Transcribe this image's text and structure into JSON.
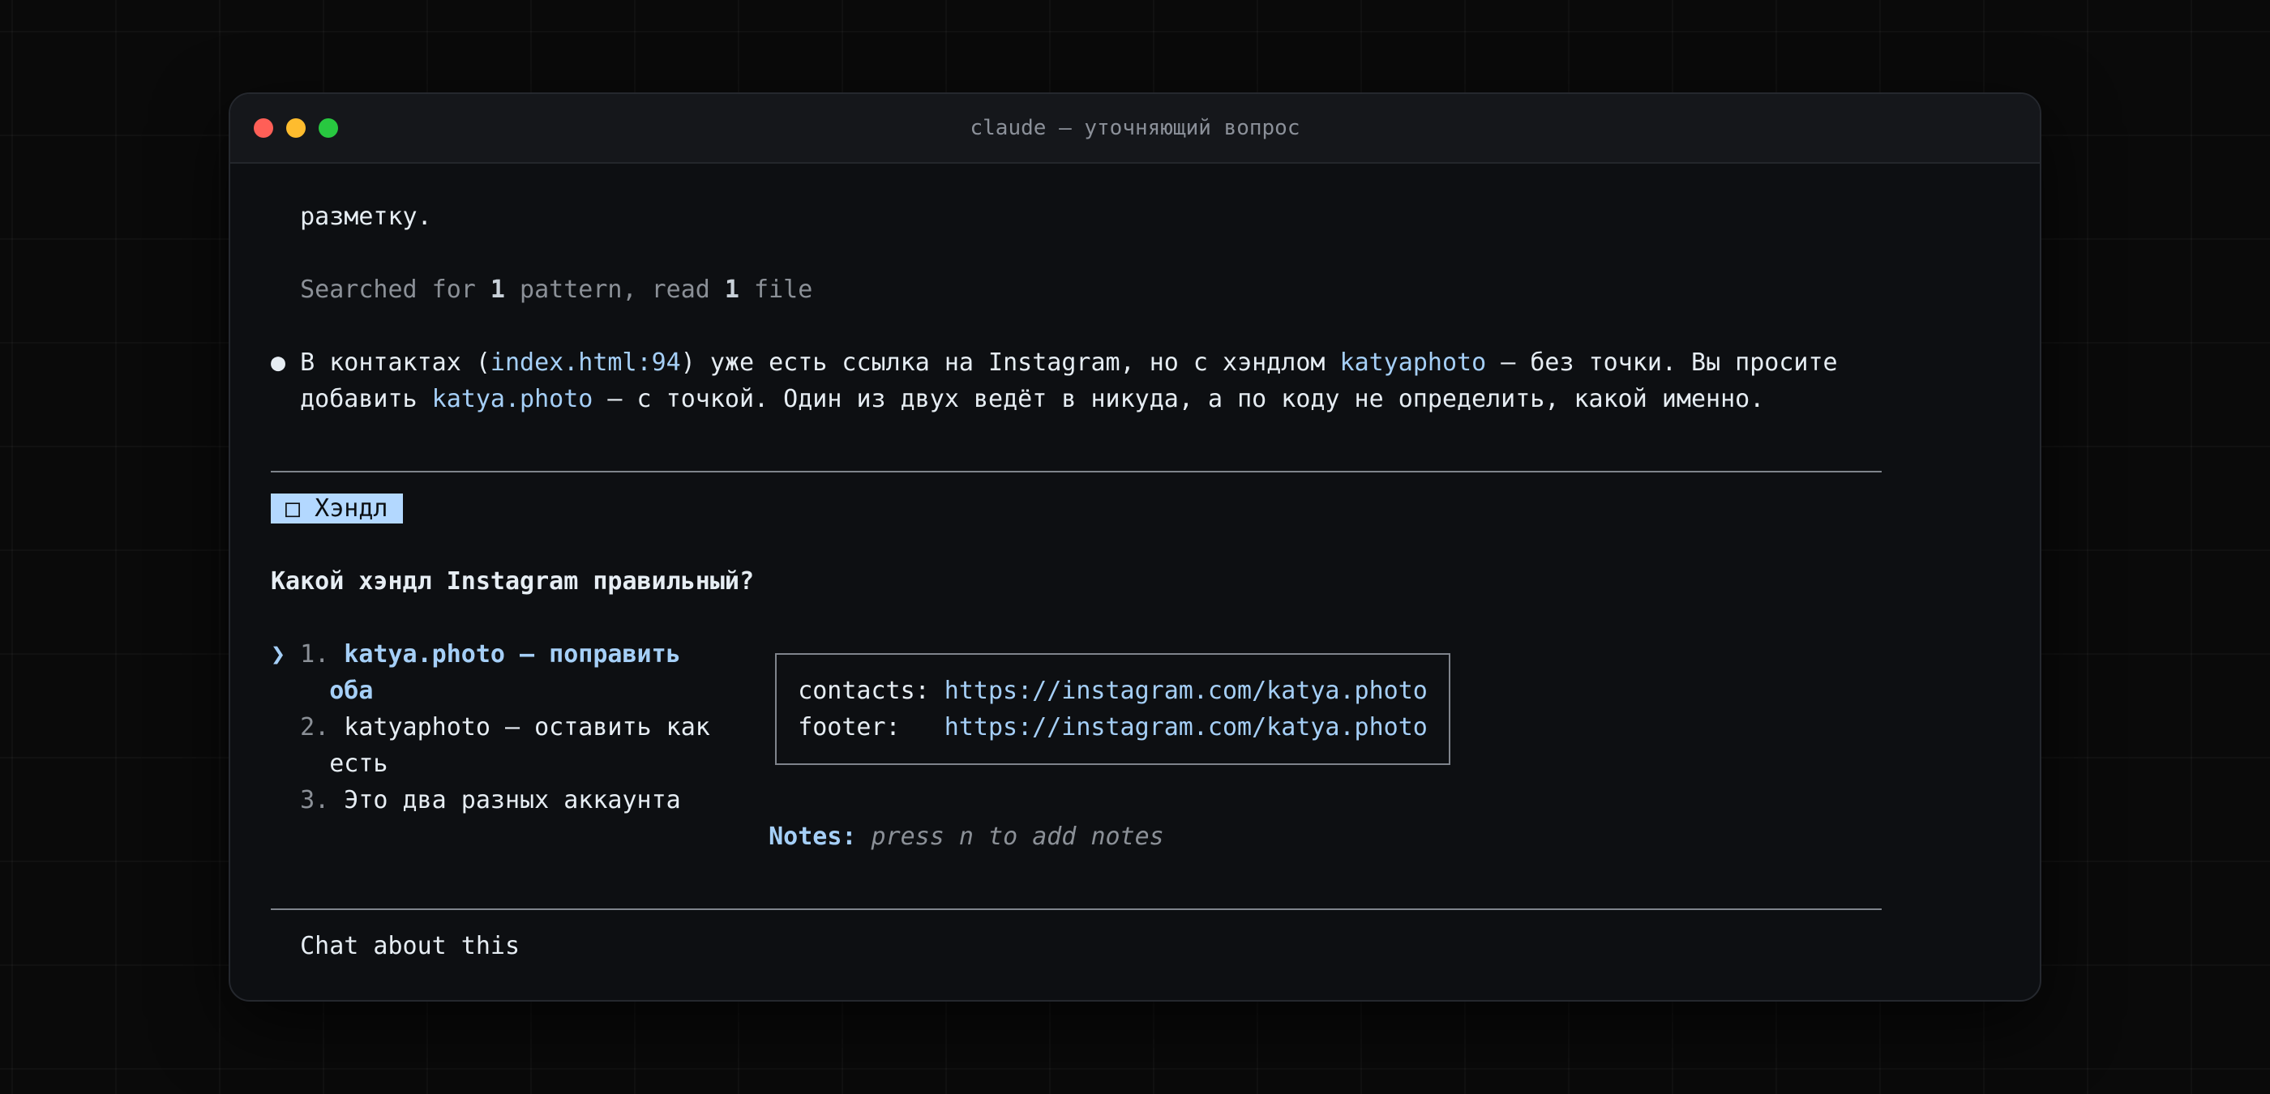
{
  "window": {
    "title": "claude — уточняющий вопрос",
    "traffic_lights": {
      "close": "#ff5f57",
      "minimize": "#febc2e",
      "zoom": "#28c840"
    }
  },
  "colors": {
    "accent": "#a5cff7",
    "text": "#e6edf3",
    "muted": "#8b9097",
    "tag_background": "#b3d8ff",
    "rule": "#7f848c",
    "window_background": "#0d0f12",
    "titlebar_background": "#15171b"
  },
  "transcript": {
    "previous_line": "разметку.",
    "tool_summary": {
      "prefix": "Searched for ",
      "patterns": "1",
      "middle": " pattern, read ",
      "files": "1",
      "suffix": " file"
    },
    "message": {
      "bullet": "●",
      "line1": {
        "t1": "В контактах (",
        "file_ref": "index.html:94",
        "t2": ") уже есть ссылка на Instagram, но с хэндлом ",
        "current_handle": "katyaphoto",
        "t3": " — без точки. Вы просите"
      },
      "line2": {
        "t1": "добавить ",
        "requested_handle": "katya.photo",
        "t2": " — с точкой. Один из двух ведёт в никуда, а по коду не определить, какой именно."
      }
    }
  },
  "question": {
    "tag": {
      "marker": "□",
      "label": "Хэндл",
      "icon": "checkbox-icon"
    },
    "text": "Какой хэндл Instagram правильный?",
    "cursor": "❯",
    "options": [
      {
        "number": "1.",
        "label_lines": [
          "katya.photo — поправить",
          "оба"
        ],
        "selected": true
      },
      {
        "number": "2.",
        "label_lines": [
          "katyaphoto — оставить как",
          "есть"
        ],
        "selected": false
      },
      {
        "number": "3.",
        "label_lines": [
          "Это два разных аккаунта"
        ],
        "selected": false
      }
    ],
    "preview": {
      "rows": [
        {
          "key": "contacts:",
          "value": "https://instagram.com/katya.photo"
        },
        {
          "key": "footer:",
          "value": "https://instagram.com/katya.photo"
        }
      ]
    },
    "notes": {
      "label": "Notes:",
      "placeholder": "press n to add notes"
    }
  },
  "footer": {
    "chat_label": "Chat about this"
  }
}
